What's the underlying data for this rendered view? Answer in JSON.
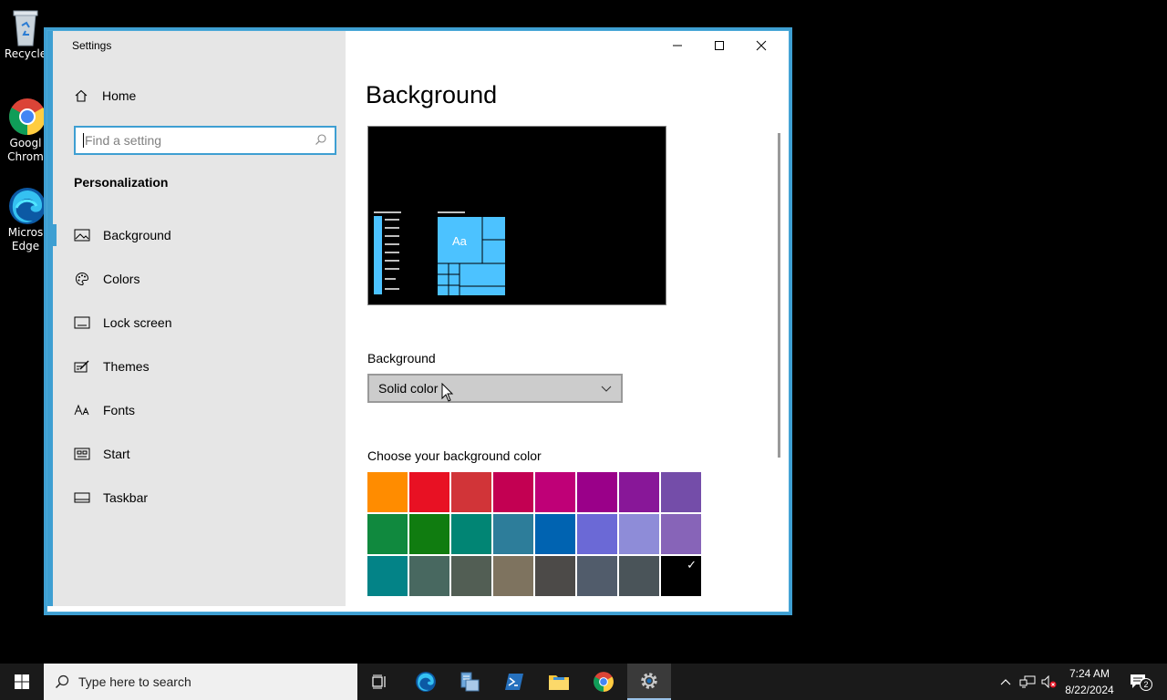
{
  "desktop": {
    "icons": [
      {
        "label": "Recycle"
      },
      {
        "label": "Googl\nChrom"
      },
      {
        "label": "Micros\nEdge"
      }
    ]
  },
  "window": {
    "title": "Settings",
    "accent_color": "#3e9fd2"
  },
  "sidebar": {
    "home_label": "Home",
    "search_placeholder": "Find a setting",
    "section_title": "Personalization",
    "items": [
      {
        "label": "Background",
        "icon": "picture-icon",
        "active": true
      },
      {
        "label": "Colors",
        "icon": "palette-icon",
        "active": false
      },
      {
        "label": "Lock screen",
        "icon": "lock-screen-icon",
        "active": false
      },
      {
        "label": "Themes",
        "icon": "themes-icon",
        "active": false
      },
      {
        "label": "Fonts",
        "icon": "fonts-icon",
        "active": false
      },
      {
        "label": "Start",
        "icon": "start-icon",
        "active": false
      },
      {
        "label": "Taskbar",
        "icon": "taskbar-icon",
        "active": false
      }
    ]
  },
  "content": {
    "title": "Background",
    "preview_tile_text": "Aa",
    "background_label": "Background",
    "background_value": "Solid color",
    "color_label": "Choose your background color",
    "swatches": [
      "#ff8c00",
      "#e81123",
      "#d13438",
      "#c30052",
      "#bf0077",
      "#9a0089",
      "#881798",
      "#744da9",
      "#10893e",
      "#107c10",
      "#018574",
      "#2d7d9a",
      "#0063b1",
      "#6b69d6",
      "#8e8cd8",
      "#8764b8",
      "#038387",
      "#486860",
      "#525e54",
      "#7e735f",
      "#4c4a48",
      "#515c6b",
      "#4a5459",
      "#000000"
    ],
    "selected_swatch_index": 23
  },
  "taskbar": {
    "search_placeholder": "Type here to search",
    "time": "7:24 AM",
    "date": "8/22/2024",
    "notification_count": "2"
  }
}
